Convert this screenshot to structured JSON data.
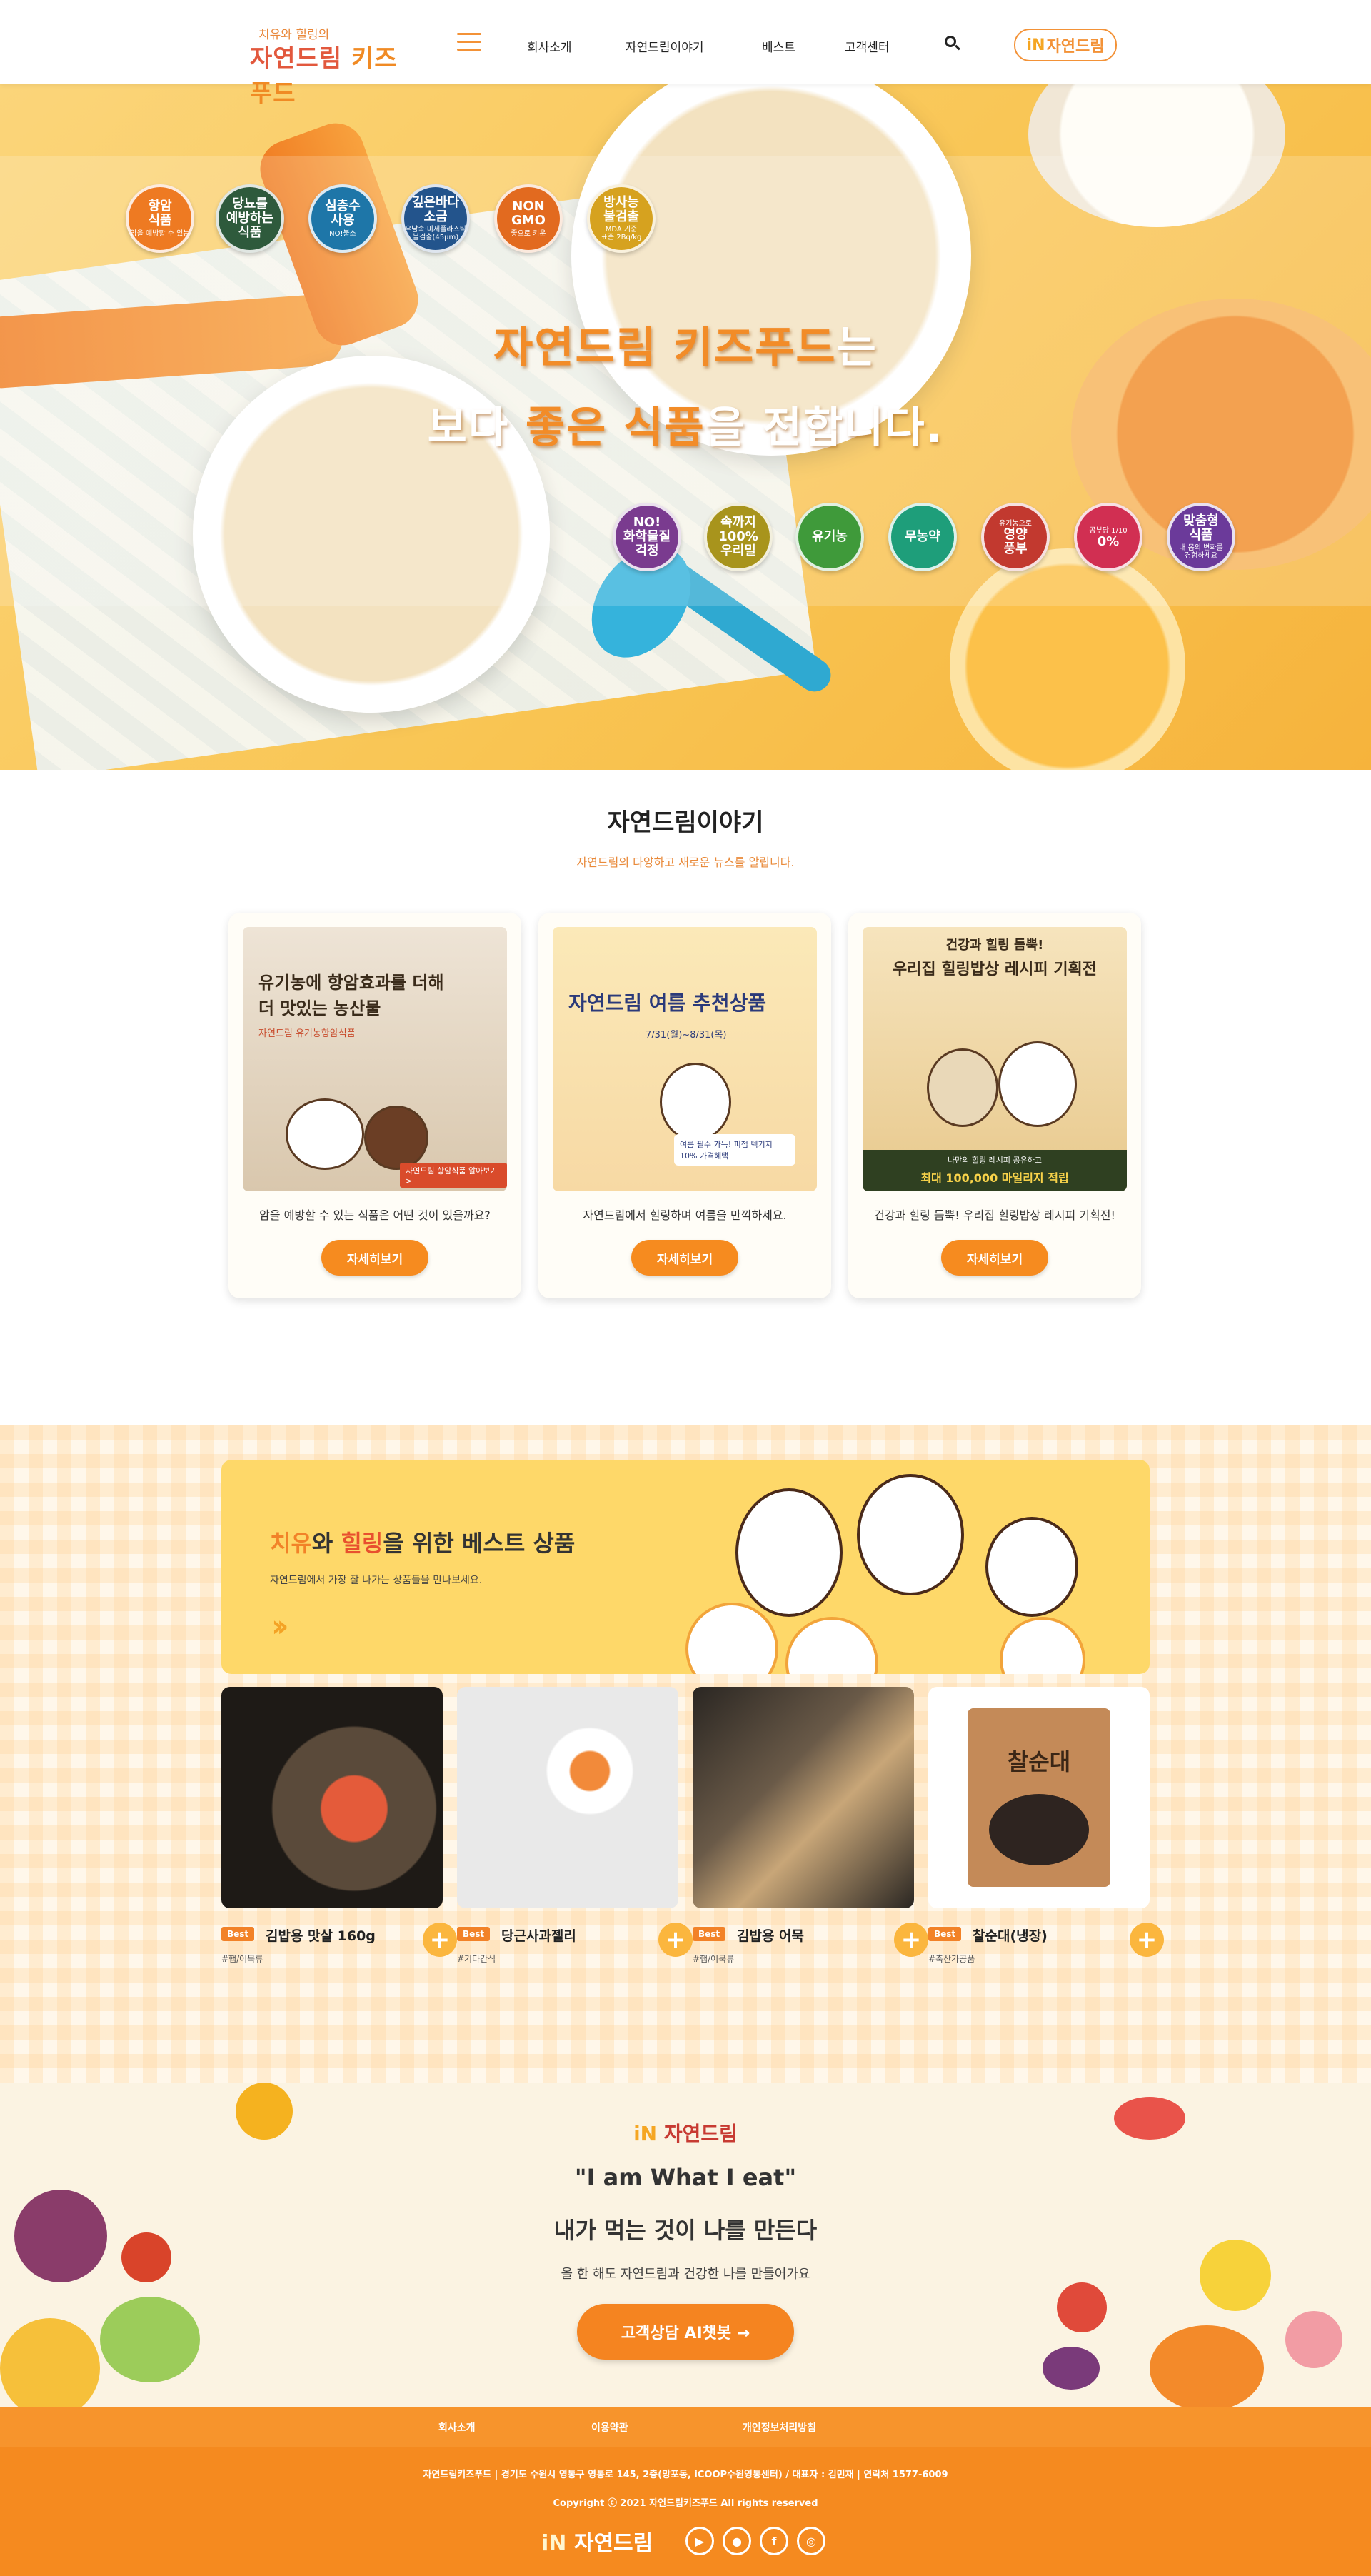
{
  "header": {
    "logo_sub": "치유와 힐링의",
    "logo_main_1": "자연드림",
    "logo_main_2": " 키즈푸드",
    "nav": [
      "회사소개",
      "자연드림이야기",
      "베스트",
      "고객센터"
    ],
    "badge_in": "iN",
    "badge_text": "자연드림"
  },
  "hero": {
    "title_1a": "자연드림 키즈푸드",
    "title_1b": "는",
    "title_2a": "보다 ",
    "title_2b": "좋은 식품",
    "title_2c": "을 전합니다.",
    "top_badges": [
      {
        "label": "항암\n식품",
        "sub": "암을 예방할 수 있는",
        "color": "#ee7a22"
      },
      {
        "label": "당뇨를\n예방하는\n식품",
        "sub": "",
        "color": "#2e5a3c"
      },
      {
        "label": "심층수\n사용",
        "sub": "NO!불소",
        "color": "#1e76a8"
      },
      {
        "label": "깊은바다\n소금",
        "sub": "우남속·미세플라스틱\n불검출(45μm)",
        "color": "#23548c"
      },
      {
        "label": "NON\nGMO",
        "sub": "좋으로 키운",
        "color": "#e26a1f"
      },
      {
        "label": "방사능\n불검출",
        "sub": "MDA 기준\n표준 2Bq/kg",
        "color": "#d6a21f"
      }
    ],
    "bottom_badges": [
      {
        "label": "NO!\n화학물질\n걱정",
        "sub": "",
        "color": "#7a3b8f"
      },
      {
        "label": "속까지\n100%\n우리밀",
        "sub": "",
        "color": "#a8941c"
      },
      {
        "label": "유기농",
        "sub": "",
        "color": "#3f9a3a"
      },
      {
        "label": "무농약",
        "sub": "",
        "color": "#1e9e7a"
      },
      {
        "label": "영양\n풍부",
        "sub": "유기농으로",
        "color": "#c2392f"
      },
      {
        "label": "0%",
        "sub": "공부당 1/10",
        "color": "#d12f52"
      },
      {
        "label": "맞춤형\n식품",
        "sub": "내 몸의 변화를\n경험하세요",
        "color": "#6b3a9a"
      }
    ]
  },
  "story": {
    "title": "자연드림이야기",
    "subtitle": "자연드림의 다양하고 새로운 뉴스를 알립니다.",
    "cards": [
      {
        "img_line1": "유기농에 항암효과를 더해",
        "img_line2": "더 맛있는 농산물",
        "img_tag": "자연드림 유기농항암식품",
        "img_caption": "자연드림 항암식품 알아보기 >",
        "desc": "암을 예방할 수 있는 식품은 어떤 것이 있을까요?",
        "button": "자세히보기"
      },
      {
        "img_line1": "자연드림 여름 추천상품",
        "img_line2": "7/31(월)~8/31(목)",
        "img_tag": "여름 필수 가득! 피첩 텍기지 10% 가격혜택",
        "img_caption": "",
        "desc": "자연드림에서 힐링하며 여름을 만끽하세요.",
        "button": "자세히보기"
      },
      {
        "img_line1": "건강과 힐링 듬뿍!",
        "img_line2": "우리집 힐링밥상 레시피 기획전",
        "img_tag": "나만의 힐링 레시피 공유하고",
        "img_caption": "최대 100,000 마일리지 적립",
        "desc": "건강과 힐링 듬뿍! 우리집 힐링밥상 레시피 기획전!",
        "button": "자세히보기"
      }
    ]
  },
  "best": {
    "title_a": "치유",
    "title_b": "와 ",
    "title_c": "힐링",
    "title_d": "을 위한 베스트 상품",
    "subtitle": "자연드림에서 가장 잘 나가는 상품들을 만나보세요.",
    "tag": "Best",
    "products": [
      {
        "name": "김밥용 맛살 160g",
        "category": "#햄/어묵류",
        "plus": "+"
      },
      {
        "name": "당근사과젤리",
        "category": "#기타간식",
        "plus": "+"
      },
      {
        "name": "김밥용 어묵",
        "category": "#햄/어묵류",
        "plus": "+"
      },
      {
        "name": "찰순대(냉장)",
        "category": "#축산가공품",
        "plus": "+"
      }
    ],
    "product4_label": "찰순대"
  },
  "slogan": {
    "logo_in": "iN",
    "logo_text": "자연드림",
    "english": "\"I am What I eat\"",
    "korean": "내가 먹는 것이 나를 만든다",
    "sub": "올 한 해도 자연드림과 건강한 나를 만들어가요",
    "button": "고객상담 AI챗봇 →"
  },
  "footer": {
    "nav": [
      "회사소개",
      "이용약관",
      "개인정보처리방침"
    ],
    "info": "자연드림키즈푸드 | 경기도 수원시 영통구 영통로 145, 2층(망포동, iCOOP수원영통센터) / 대표자 : 김민재 | 연락처 1577-6009",
    "copyright": "Copyright ⓒ 2021 자연드림키즈푸드 All rights reserved",
    "logo_in": "iN",
    "logo_text": "자연드림",
    "sns": [
      "youtube-icon",
      "talk-icon",
      "facebook-icon",
      "instagram-icon"
    ]
  }
}
